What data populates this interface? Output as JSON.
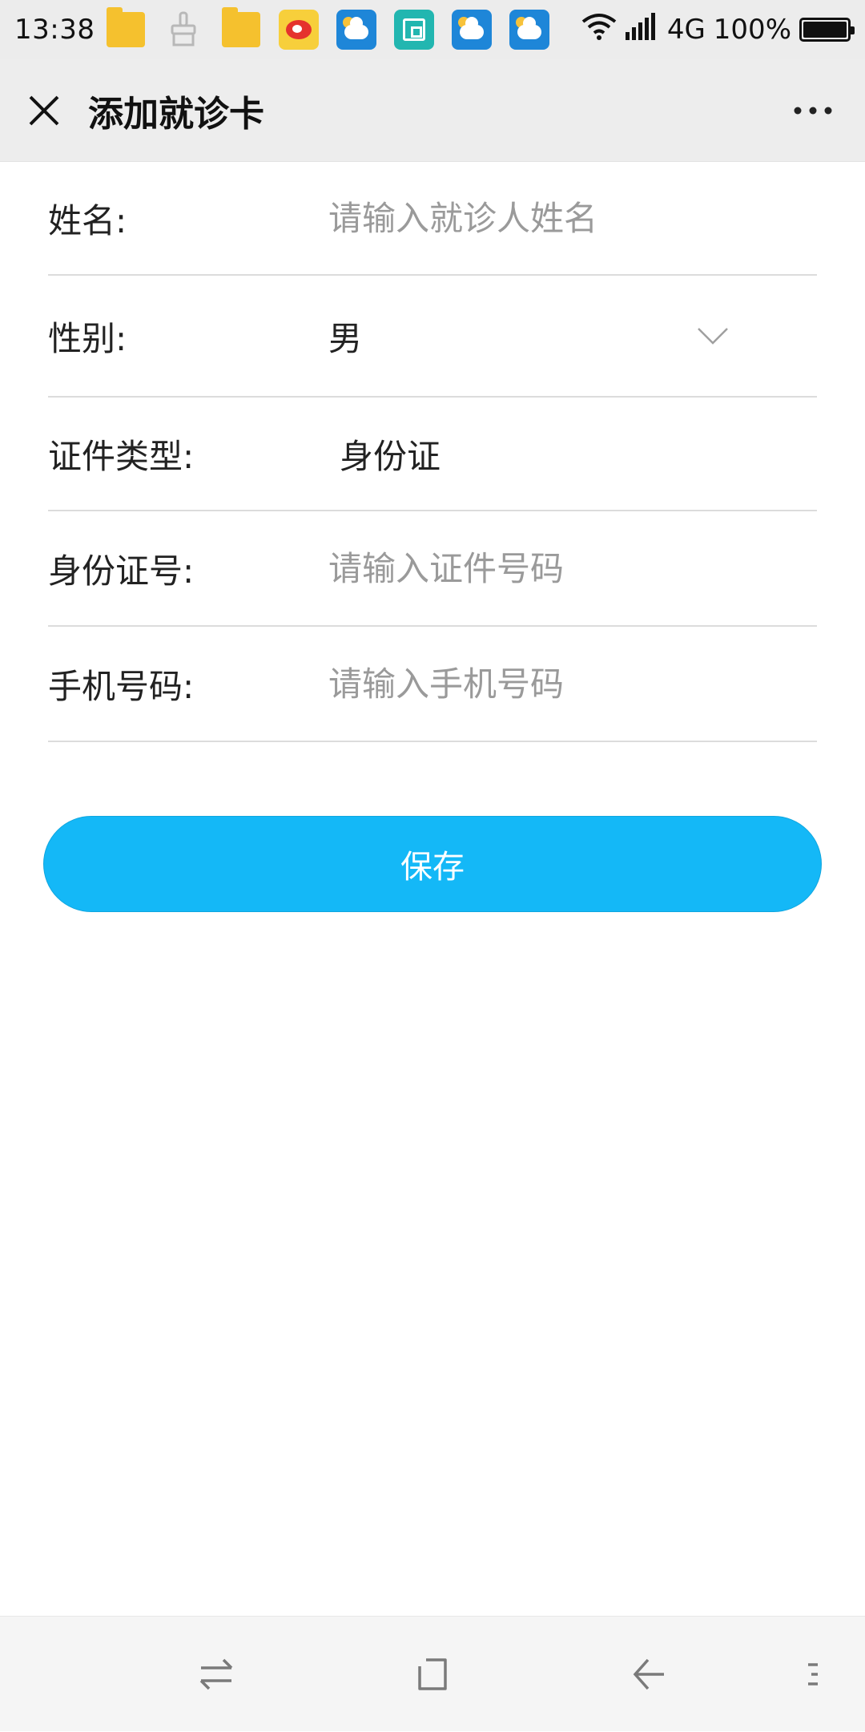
{
  "status_bar": {
    "time": "13:38",
    "network": "4G",
    "battery": "100%",
    "notification_icons": [
      "folder-icon",
      "brush-icon",
      "folder-icon",
      "weibo-icon",
      "weather-icon",
      "scan-icon",
      "weather-icon",
      "weather-icon"
    ]
  },
  "header": {
    "title": "添加就诊卡"
  },
  "form": {
    "name": {
      "label": "姓名:",
      "value": "",
      "placeholder": "请输入就诊人姓名"
    },
    "gender": {
      "label": "性别:",
      "value": "男"
    },
    "id_type": {
      "label": "证件类型:",
      "value": "身份证"
    },
    "id_number": {
      "label": "身份证号:",
      "value": "",
      "placeholder": "请输入证件号码"
    },
    "phone": {
      "label": "手机号码:",
      "value": "",
      "placeholder": "请输入手机号码"
    }
  },
  "actions": {
    "save_label": "保存"
  },
  "theme": {
    "accent": "#14b8f7",
    "header_bg": "#ededed",
    "placeholder": "#9a9a9a"
  },
  "nav_bar": {
    "icons": [
      "switch-icon",
      "home-square-icon",
      "back-arrow-icon",
      "menu-icon"
    ]
  }
}
